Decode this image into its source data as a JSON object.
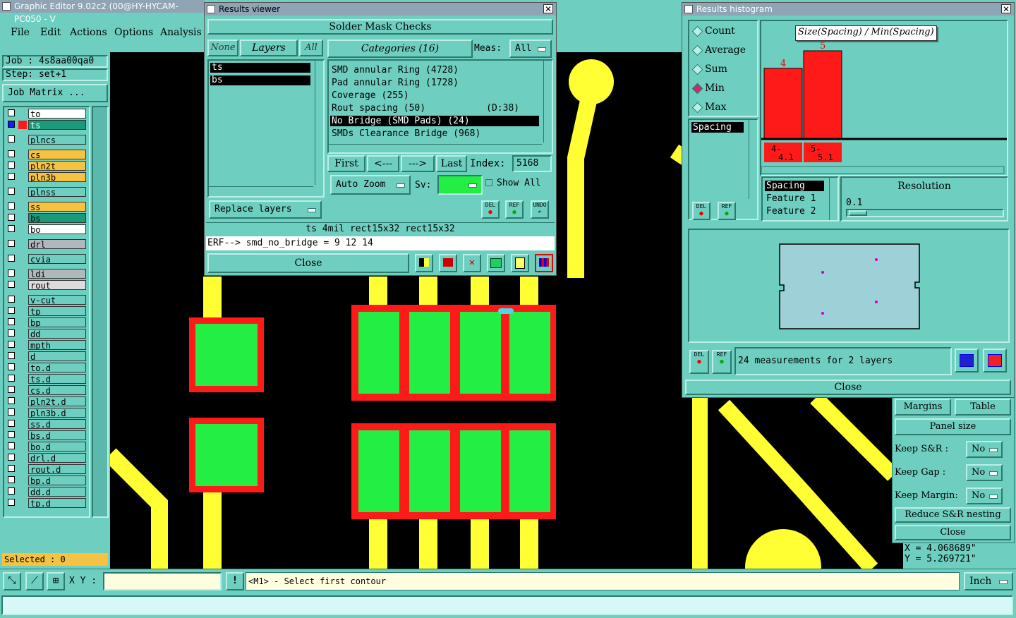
{
  "app": {
    "title": "Graphic Editor 9.02c2 (00@HY-HYCAM-PC050 - V",
    "menu": [
      "File",
      "Edit",
      "Actions",
      "Options",
      "Analysis"
    ],
    "job": "Job : 4s8aa00qa0",
    "step": "Step: set+1",
    "job_matrix": "Job Matrix ...",
    "selected": "Selected : 0",
    "xy_label": "X Y :",
    "status_msg": "<M1> - Select first contour",
    "units": "Inch",
    "coord_x": "X = 4.068689\"",
    "coord_y": "Y = 5.269721\""
  },
  "layers": [
    {
      "name": "to",
      "color": "#ffffff"
    },
    {
      "name": "ts",
      "color": "#1a9a78",
      "active": true
    },
    {
      "name": "plncs",
      "color": "#6ecfc0"
    },
    {
      "name": "cs",
      "color": "#f5c242"
    },
    {
      "name": "pln2t",
      "color": "#f5c242"
    },
    {
      "name": "pln3b",
      "color": "#f5c242"
    },
    {
      "name": "plnss",
      "color": "#6ecfc0"
    },
    {
      "name": "ss",
      "color": "#f5c242"
    },
    {
      "name": "bs",
      "color": "#1a9a78"
    },
    {
      "name": "bo",
      "color": "#ffffff"
    },
    {
      "name": "drl",
      "color": "#b0b8bc"
    },
    {
      "name": "cvia",
      "color": "#6ecfc0"
    },
    {
      "name": "ldi",
      "color": "#b0b8bc"
    },
    {
      "name": "rout",
      "color": "#dcdcdc"
    },
    {
      "name": "v-cut",
      "color": "#6ecfc0"
    },
    {
      "name": "tp",
      "color": "#6ecfc0"
    },
    {
      "name": "bp",
      "color": "#6ecfc0"
    },
    {
      "name": "dd",
      "color": "#6ecfc0"
    },
    {
      "name": "mpth",
      "color": "#6ecfc0"
    },
    {
      "name": "d",
      "color": "#6ecfc0"
    },
    {
      "name": "to.d",
      "color": "#6ecfc0"
    },
    {
      "name": "ts.d",
      "color": "#6ecfc0"
    },
    {
      "name": "cs.d",
      "color": "#6ecfc0"
    },
    {
      "name": "pln2t.d",
      "color": "#6ecfc0"
    },
    {
      "name": "pln3b.d",
      "color": "#6ecfc0"
    },
    {
      "name": "ss.d",
      "color": "#6ecfc0"
    },
    {
      "name": "bs.d",
      "color": "#6ecfc0"
    },
    {
      "name": "bo.d",
      "color": "#6ecfc0"
    },
    {
      "name": "drl.d",
      "color": "#6ecfc0"
    },
    {
      "name": "rout.d",
      "color": "#6ecfc0"
    },
    {
      "name": "bp.d",
      "color": "#6ecfc0"
    },
    {
      "name": "dd.d",
      "color": "#6ecfc0"
    },
    {
      "name": "tp.d",
      "color": "#6ecfc0"
    }
  ],
  "results_viewer": {
    "title": "Results viewer",
    "header": "Solder Mask Checks",
    "none_btn": "None",
    "layers_btn": "Layers",
    "all_btn": "All",
    "categories_btn": "Categories (16)",
    "meas_label": "Meas:",
    "meas_value": "All",
    "layer_list": [
      "ts",
      "bs"
    ],
    "categories": [
      "SMD annular Ring (4728)",
      "Pad annular Ring (1728)",
      "Coverage (255)",
      "Rout spacing (50)           (D:38)",
      "No Bridge (SMD Pads) (24)",
      "SMDs Clearance Bridge (968)"
    ],
    "first": "First",
    "prev": "<---",
    "next": "--->",
    "last": "Last",
    "index_label": "Index:",
    "index_value": "5168",
    "auto_zoom": "Auto Zoom",
    "sv_label": "Sv:",
    "show_all": "Show All",
    "replace_layers": "Replace layers",
    "info_line": "ts 4mil  rect15x32  rect15x32",
    "erf_line": "ERF--> smd_no_bridge = 9 12 14",
    "close": "Close",
    "del": "DEL",
    "ref": "REF",
    "undo": "UNDO"
  },
  "histogram": {
    "title": "Results histogram",
    "options": [
      "Count",
      "Average",
      "Sum",
      "Min",
      "Max"
    ],
    "selected_option": "Min",
    "chart_title": "Size(Spacing) / Min(Spacing)",
    "measure_list": [
      "Spacing"
    ],
    "feature_list": [
      "Spacing",
      "Feature 1",
      "Feature 2"
    ],
    "resolution_label": "Resolution",
    "resolution_value": "0.1",
    "summary": "24 measurements for 2 layers",
    "close": "Close",
    "del": "DEL",
    "ref": "REF"
  },
  "chart_data": {
    "type": "bar",
    "title": "Size(Spacing) / Min(Spacing)",
    "categories": [
      "4-\n4.1",
      "5-\n5.1"
    ],
    "values": [
      4,
      5
    ],
    "bar_color": "#ff1a1a"
  },
  "panel_form": {
    "margins": "Margins",
    "table": "Table",
    "panel_size": "Panel size",
    "keep_sr": "Keep S&R  :",
    "keep_gap": "Keep Gap   :",
    "keep_margin": "Keep Margin:",
    "no": "No",
    "reduce": "Reduce S&R nesting",
    "close": "Close"
  }
}
